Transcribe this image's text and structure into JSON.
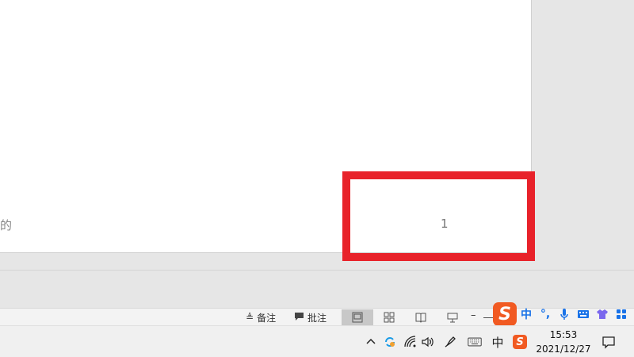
{
  "document": {
    "text_fragment": "的",
    "page_number": "1"
  },
  "status_bar": {
    "notes_label": "备注",
    "comments_label": "批注",
    "zoom_minus": "–"
  },
  "ime": {
    "logo_text": "S",
    "mode_label": "中",
    "punct_label": "°,"
  },
  "taskbar": {
    "ime_lang": "中",
    "time": "15:53",
    "date": "2021/12/27"
  },
  "colors": {
    "highlight": "#e8222a",
    "sogou_orange": "#f15a22",
    "ime_blue": "#1a73e8"
  }
}
